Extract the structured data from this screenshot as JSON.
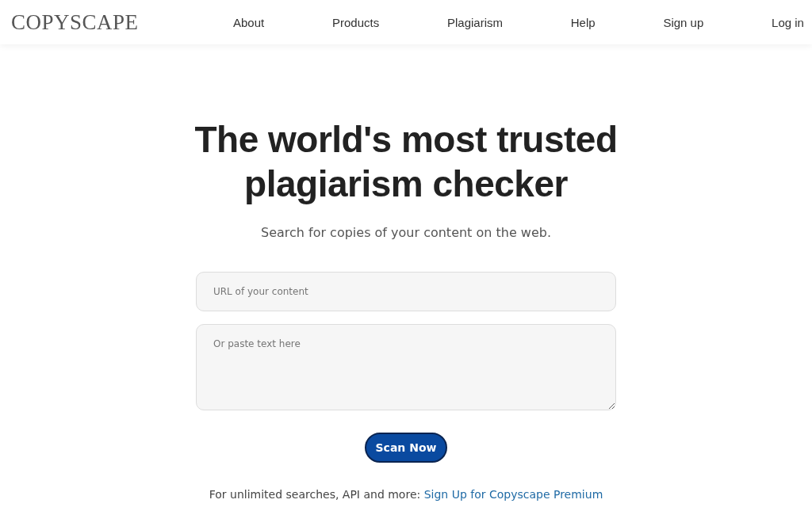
{
  "header": {
    "logo": "COPYSCAPE",
    "nav": [
      "About",
      "Products",
      "Plagiarism",
      "Help",
      "Sign up",
      "Log in"
    ]
  },
  "hero": {
    "title": "The world's most trusted plagiarism checker",
    "subtitle": "Search for copies of your content on the web."
  },
  "form": {
    "url_field": {
      "placeholder": "URL of your content"
    },
    "text_field": {
      "placeholder": "Or paste text here"
    },
    "button": "Scan Now"
  },
  "footer": {
    "text": "For unlimited searches, API and more:",
    "link": "Sign Up for Copyscape Premium"
  }
}
